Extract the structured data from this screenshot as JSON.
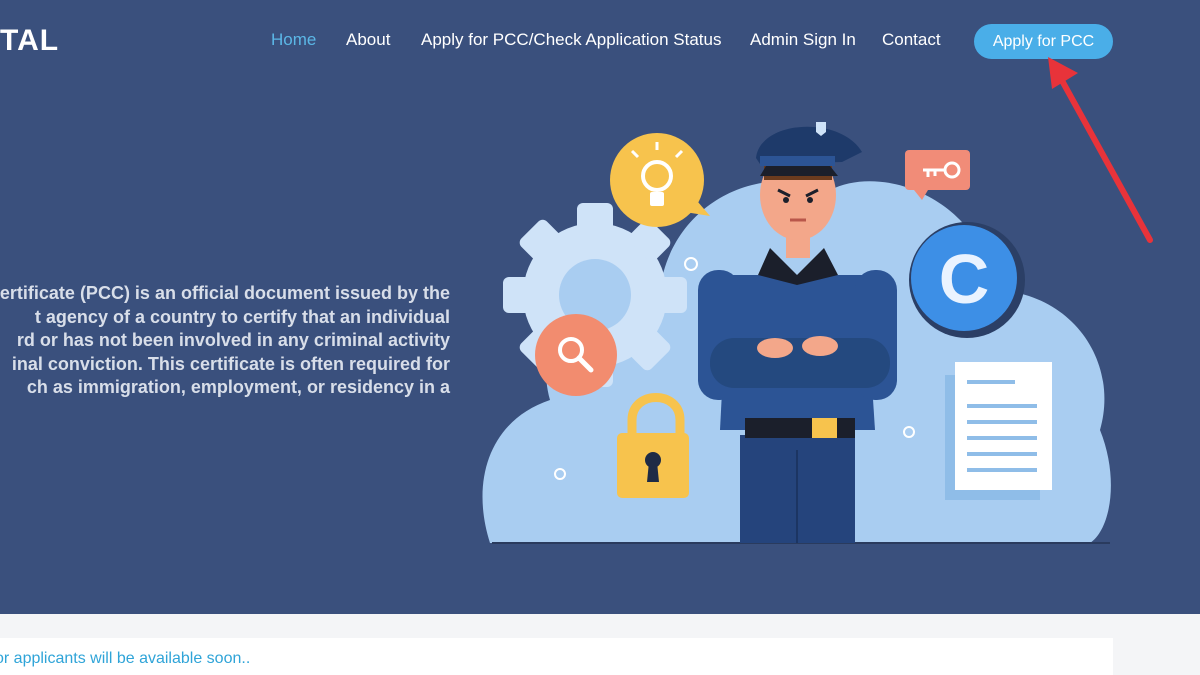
{
  "brand": {
    "text": "TAL"
  },
  "nav": {
    "items": [
      {
        "label": "Home",
        "active": true
      },
      {
        "label": "About"
      },
      {
        "label": "Apply for PCC/Check Application Status"
      },
      {
        "label": "Admin Sign In"
      },
      {
        "label": "Contact"
      }
    ],
    "cta_label": "Apply for PCC"
  },
  "hero": {
    "lines": [
      "ertificate (PCC) is an official document issued by the",
      "t agency of a country to certify that an individual",
      "rd or has not been involved in any criminal activity",
      "inal conviction. This certificate is often required for",
      "ch as immigration, employment, or residency in a"
    ],
    "illustration_badge_letter": "C"
  },
  "notice": {
    "text": "or applicants will be available soon.."
  },
  "colors": {
    "hero_bg": "#3a507d",
    "accent": "#4aaee8",
    "active_link": "#5bb7e6",
    "arrow": "#e8333a"
  },
  "icons": [
    "lightbulb-icon",
    "key-icon",
    "search-icon",
    "padlock-icon",
    "gear-icon",
    "document-icon",
    "copyright-badge-icon",
    "red-arrow-icon"
  ]
}
